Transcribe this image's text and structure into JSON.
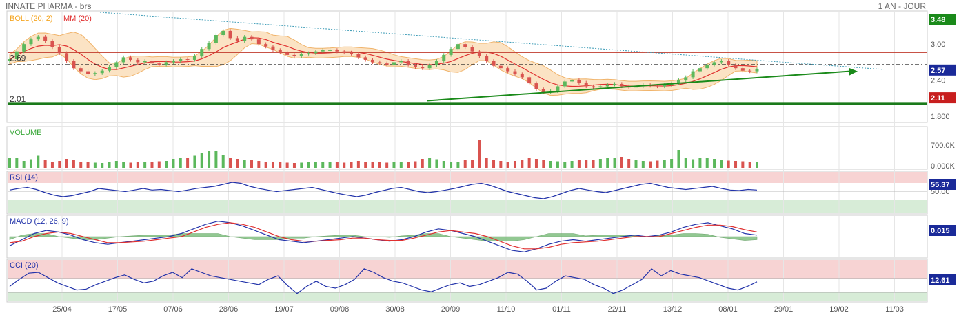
{
  "header": {
    "title": "INNATE PHARMA - brs",
    "period": "1 AN - JOUR"
  },
  "colors": {
    "up": "#5cb85c",
    "down": "#d9534f",
    "boll": "#f5a623",
    "mm": "#e03030",
    "line_blue": "#2233aa",
    "trend": "#1a8a1a",
    "grid": "#e6e6e6",
    "zone_red": "#f7d3d3",
    "zone_green": "#d7ecd7"
  },
  "x_labels": [
    "25/04",
    "17/05",
    "07/06",
    "28/06",
    "19/07",
    "09/08",
    "30/08",
    "20/09",
    "11/10",
    "01/11",
    "22/11",
    "13/12",
    "08/01",
    "29/01",
    "19/02",
    "11/03"
  ],
  "chart_data": [
    {
      "type": "candlestick",
      "panel": "price",
      "legend": [
        "BOLL (20, 2)",
        "MM (20)"
      ],
      "y_ticks": [
        "3.00",
        "2.40",
        "1.800"
      ],
      "ylim": [
        1.7,
        3.55
      ],
      "levels": [
        {
          "label": "3.48",
          "value": 3.48,
          "color": "#1a8a1a"
        },
        {
          "label": "2.57",
          "value": 2.57,
          "color": "#1a2a99"
        },
        {
          "label": "2.11",
          "value": 2.11,
          "color": "#c81e1e"
        }
      ],
      "left_labels": [
        {
          "label": "2.69",
          "value": 2.69
        },
        {
          "label": "2.01",
          "value": 2.01
        }
      ],
      "horizontal_lines": [
        {
          "value": 2.86,
          "style": "solid-red"
        },
        {
          "value": 2.66,
          "style": "dash-dot"
        },
        {
          "value": 2.01,
          "style": "solid-green"
        }
      ],
      "close": [
        2.75,
        2.88,
        3.0,
        3.08,
        3.12,
        3.05,
        2.95,
        2.85,
        2.72,
        2.6,
        2.55,
        2.5,
        2.52,
        2.56,
        2.62,
        2.7,
        2.78,
        2.74,
        2.7,
        2.72,
        2.68,
        2.66,
        2.7,
        2.72,
        2.75,
        2.74,
        2.8,
        2.92,
        3.02,
        3.15,
        3.22,
        3.1,
        3.05,
        3.12,
        3.08,
        3.0,
        2.96,
        2.9,
        2.86,
        2.82,
        2.8,
        2.84,
        2.85,
        2.88,
        2.9,
        2.9,
        2.88,
        2.86,
        2.84,
        2.78,
        2.74,
        2.7,
        2.68,
        2.66,
        2.7,
        2.72,
        2.66,
        2.62,
        2.6,
        2.65,
        2.72,
        2.82,
        2.92,
        3.0,
        2.95,
        2.88,
        2.8,
        2.72,
        2.64,
        2.6,
        2.55,
        2.5,
        2.45,
        2.35,
        2.25,
        2.2,
        2.22,
        2.3,
        2.38,
        2.4,
        2.36,
        2.3,
        2.28,
        2.3,
        2.33,
        2.34,
        2.3,
        2.28,
        2.3,
        2.32,
        2.31,
        2.3,
        2.32,
        2.35,
        2.4,
        2.45,
        2.55,
        2.6,
        2.66,
        2.7,
        2.72,
        2.66,
        2.6,
        2.56,
        2.55,
        2.58
      ],
      "volume": [
        280,
        300,
        200,
        250,
        350,
        220,
        180,
        200,
        260,
        240,
        180,
        160,
        150,
        140,
        170,
        200,
        180,
        150,
        160,
        180,
        170,
        190,
        200,
        260,
        280,
        300,
        350,
        420,
        500,
        480,
        360,
        300,
        260,
        240,
        220,
        200,
        180,
        170,
        160,
        150,
        140,
        150,
        160,
        170,
        180,
        170,
        160,
        150,
        160,
        200,
        180,
        170,
        160,
        150,
        180,
        170,
        160,
        190,
        260,
        300,
        250,
        200,
        180,
        170,
        230,
        240,
        800,
        300,
        220,
        200,
        180,
        200,
        240,
        300,
        260,
        220,
        200,
        190,
        180,
        200,
        220,
        230,
        240,
        260,
        280,
        300,
        320,
        260,
        220,
        200,
        190,
        210,
        230,
        260,
        520,
        300,
        250,
        280,
        300,
        260,
        230,
        210,
        200,
        190,
        180,
        180
      ],
      "volume_ticks": [
        "700.0K",
        "0.000K"
      ],
      "trend_line": {
        "from": [
          143,
          2.06
        ],
        "to": [
          256,
          2.55
        ],
        "color": "#1a8a1a"
      },
      "resistance_line": {
        "from": [
          31,
          3.5
        ],
        "to": [
          304,
          2.56
        ],
        "color": "#3a9ab5"
      }
    },
    {
      "type": "line",
      "panel": "rsi",
      "label": "RSI (14)",
      "y_ticks": [
        "50.00"
      ],
      "levels": [
        {
          "label": "55.37",
          "value": 55.37
        }
      ],
      "values": [
        55,
        58,
        60,
        56,
        50,
        45,
        42,
        44,
        48,
        52,
        58,
        56,
        54,
        52,
        55,
        58,
        55,
        56,
        54,
        52,
        55,
        58,
        60,
        62,
        66,
        70,
        68,
        62,
        58,
        55,
        52,
        54,
        56,
        58,
        60,
        56,
        52,
        48,
        45,
        42,
        45,
        50,
        54,
        58,
        60,
        56,
        52,
        50,
        52,
        55,
        58,
        62,
        66,
        68,
        64,
        58,
        52,
        48,
        44,
        40,
        38,
        42,
        48,
        54,
        58,
        55,
        52,
        50,
        54,
        58,
        62,
        66,
        68,
        64,
        60,
        58,
        56,
        58,
        60,
        62,
        58,
        55,
        54,
        56,
        55
      ]
    },
    {
      "type": "line",
      "panel": "macd",
      "label": "MACD (12, 26, 9)",
      "levels": [
        {
          "label": "0.015",
          "value": 0.015
        }
      ],
      "macd": [
        -0.06,
        -0.02,
        0.02,
        0.04,
        0.03,
        0.01,
        -0.02,
        -0.04,
        -0.05,
        -0.04,
        -0.03,
        -0.02,
        -0.01,
        0.0,
        0.02,
        0.05,
        0.08,
        0.1,
        0.09,
        0.07,
        0.04,
        0.01,
        -0.02,
        -0.03,
        -0.04,
        -0.03,
        -0.02,
        -0.01,
        0.0,
        -0.01,
        -0.02,
        -0.03,
        -0.02,
        0.0,
        0.03,
        0.05,
        0.04,
        0.02,
        0.0,
        -0.03,
        -0.06,
        -0.09,
        -0.1,
        -0.08,
        -0.05,
        -0.03,
        -0.02,
        -0.03,
        -0.02,
        -0.01,
        0.0,
        0.01,
        0.0,
        0.01,
        0.03,
        0.06,
        0.08,
        0.09,
        0.07,
        0.05,
        0.02,
        0.01
      ],
      "signal": [
        -0.04,
        -0.03,
        0.0,
        0.02,
        0.03,
        0.02,
        0.0,
        -0.02,
        -0.04,
        -0.04,
        -0.035,
        -0.03,
        -0.02,
        -0.01,
        0.0,
        0.03,
        0.06,
        0.08,
        0.09,
        0.08,
        0.06,
        0.03,
        0.0,
        -0.02,
        -0.03,
        -0.03,
        -0.025,
        -0.02,
        -0.01,
        -0.01,
        -0.02,
        -0.025,
        -0.025,
        -0.01,
        0.01,
        0.03,
        0.04,
        0.03,
        0.02,
        0.0,
        -0.03,
        -0.06,
        -0.08,
        -0.08,
        -0.07,
        -0.05,
        -0.04,
        -0.035,
        -0.03,
        -0.02,
        -0.01,
        0.0,
        0.0,
        0.0,
        0.02,
        0.04,
        0.06,
        0.075,
        0.075,
        0.065,
        0.045,
        0.03
      ]
    },
    {
      "type": "line",
      "panel": "cci",
      "label": "CCI (20)",
      "levels": [
        {
          "label": "12.61",
          "value": 12.61
        }
      ],
      "values": [
        -40,
        40,
        110,
        120,
        60,
        0,
        -40,
        -80,
        -70,
        -20,
        20,
        60,
        90,
        40,
        0,
        20,
        80,
        120,
        60,
        160,
        120,
        80,
        60,
        40,
        20,
        0,
        -20,
        40,
        80,
        -30,
        -120,
        -40,
        20,
        -40,
        -60,
        -20,
        40,
        160,
        120,
        60,
        20,
        0,
        -40,
        -80,
        -100,
        -60,
        -20,
        0,
        -40,
        -20,
        20,
        60,
        120,
        100,
        20,
        -80,
        -60,
        20,
        80,
        60,
        40,
        -20,
        -60,
        -120,
        -80,
        -20,
        40,
        160,
        80,
        140,
        100,
        80,
        60,
        20,
        -20,
        -60,
        -80,
        -40,
        12
      ]
    }
  ]
}
